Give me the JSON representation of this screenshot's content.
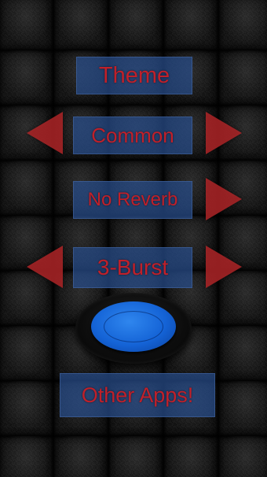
{
  "header": {
    "title": "Theme"
  },
  "options": {
    "theme_value": "Common",
    "reverb_value": "No Reverb",
    "burst_value": "3-Burst"
  },
  "footer": {
    "other_apps_label": "Other Apps!"
  },
  "icons": {
    "prev": "arrow-left-icon",
    "next": "arrow-right-icon",
    "fire": "round-blue-button-icon"
  },
  "colors": {
    "label_text": "#c0202a",
    "panel_fill": "#284e8c",
    "arrow_fill": "#be282a",
    "button_cap": "#1463d6"
  }
}
